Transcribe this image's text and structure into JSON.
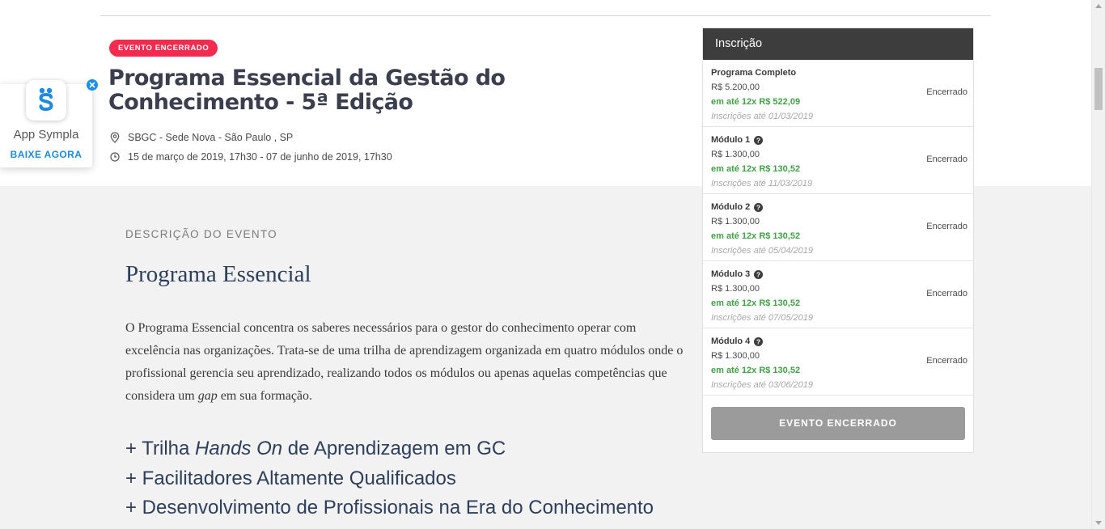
{
  "event": {
    "badge": "EVENTO ENCERRADO",
    "title": "Programa Essencial da Gestão do Conhecimento - 5ª Edição",
    "location": "SBGC - Sede Nova - São Paulo , SP",
    "dates": "15 de março de 2019, 17h30 - 07 de junho de 2019, 17h30"
  },
  "app_promo": {
    "name": "App Sympla",
    "cta": "BAIXE AGORA"
  },
  "description": {
    "label": "DESCRIÇÃO DO EVENTO",
    "heading": "Programa Essencial",
    "para_1": "O Programa Essencial concentra os saberes necessários para o gestor do conhecimento operar com excelência nas organizações. Trata-se de uma trilha de aprendizagem organizada em quatro módulos onde o profissional gerencia seu aprendizado, realizando todos os módulos ou apenas aquelas competências que considera um ",
    "para_em": "gap",
    "para_2": " em sua formação.",
    "bullet_1_pre": "+ Trilha ",
    "bullet_1_em": "Hands On",
    "bullet_1_post": " de Aprendizagem em GC",
    "bullet_2": "+ Facilitadores Altamente Qualificados",
    "bullet_3": "+ Desenvolvimento de Profissionais na Era do Conhecimento"
  },
  "registration": {
    "header": "Inscrição",
    "tickets": [
      {
        "name": "Programa Completo",
        "price": "R$ 5.200,00",
        "installments": "em até 12x R$ 522,09",
        "deadline": "Inscrições até 01/03/2019",
        "status": "Encerrado"
      },
      {
        "name": "Módulo 1",
        "price": "R$ 1.300,00",
        "installments": "em até 12x R$ 130,52",
        "deadline": "Inscrições até 11/03/2019",
        "status": "Encerrado"
      },
      {
        "name": "Módulo 2",
        "price": "R$ 1.300,00",
        "installments": "em até 12x R$ 130,52",
        "deadline": "Inscrições até 05/04/2019",
        "status": "Encerrado"
      },
      {
        "name": "Módulo 3",
        "price": "R$ 1.300,00",
        "installments": "em até 12x R$ 130,52",
        "deadline": "Inscrições até 07/05/2019",
        "status": "Encerrado"
      },
      {
        "name": "Módulo 4",
        "price": "R$ 1.300,00",
        "installments": "em até 12x R$ 130,52",
        "deadline": "Inscrições até 03/06/2019",
        "status": "Encerrado"
      }
    ],
    "button": "EVENTO ENCERRADO"
  },
  "colors": {
    "badge": "#f22b4f",
    "installments": "#43a047",
    "header_bg": "#3d3d3d",
    "app_accent": "#1e8be0"
  },
  "icons": {
    "location": "map-pin-icon",
    "date": "clock-icon",
    "help": "question-circle-icon",
    "close": "close-icon",
    "app": "sympla-logo-icon"
  }
}
